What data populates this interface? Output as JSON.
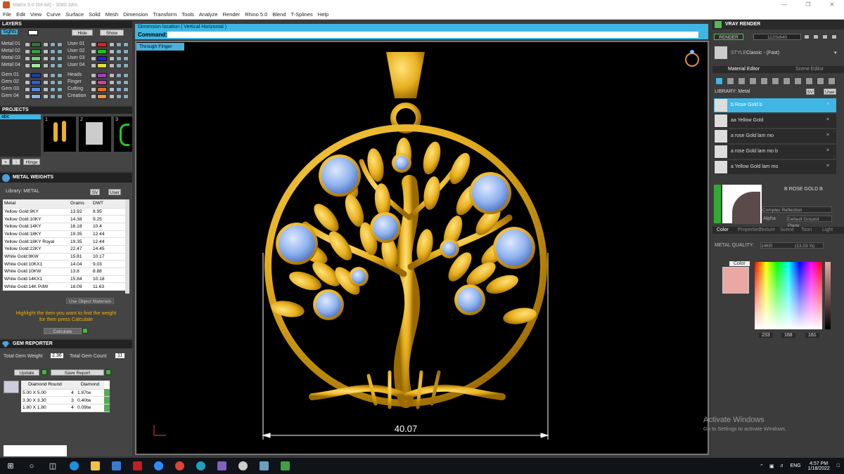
{
  "window": {
    "title": "Matrix 9.0 (64-bit) - 3080.3dm"
  },
  "menu": [
    "File",
    "Edit",
    "View",
    "Curve",
    "Surface",
    "Solid",
    "Mesh",
    "Dimension",
    "Transform",
    "Tools",
    "Analyze",
    "Render",
    "Rhino 5.0",
    "Blend",
    "T-Splines",
    "Help"
  ],
  "layers": {
    "title": "LAYERS",
    "first": "Sights",
    "hide": "Hide",
    "show": "Show",
    "left": [
      {
        "name": "Metal 01",
        "color": "#2a7a2a"
      },
      {
        "name": "Metal 02",
        "color": "#3b9a3b"
      },
      {
        "name": "Metal 03",
        "color": "#6fd06f"
      },
      {
        "name": "Metal 04",
        "color": "#9fe89f"
      },
      {
        "name": "Gem 01",
        "color": "#1a3fa0"
      },
      {
        "name": "Gem 02",
        "color": "#2d5fd0"
      },
      {
        "name": "Gem 03",
        "color": "#5a8ae0"
      },
      {
        "name": "Gem 04",
        "color": "#8db0f0"
      }
    ],
    "right": [
      {
        "name": "User 01",
        "color": "#e02020"
      },
      {
        "name": "User 02",
        "color": "#20c020"
      },
      {
        "name": "User 03",
        "color": "#2020e0"
      },
      {
        "name": "User 04",
        "color": "#e0e040"
      },
      {
        "name": "Heads",
        "color": "#a040c0"
      },
      {
        "name": "Finger",
        "color": "#d040a0"
      },
      {
        "name": "Cutting",
        "color": "#e07020"
      },
      {
        "name": "Creation",
        "color": "#f09040"
      }
    ]
  },
  "projects": {
    "title": "PROJECTS",
    "item": "abc",
    "thumbs": [
      "1",
      "2",
      "3"
    ],
    "hinge": "Hinge"
  },
  "metal_weights": {
    "title": "METAL WEIGHTS",
    "library": "Library: METAL",
    "sv": "SV",
    "user": "User",
    "headers": [
      "Metal",
      "Grams",
      "DWT"
    ],
    "rows": [
      [
        "Yellow Gold:9KY",
        "13.92",
        "8.95"
      ],
      [
        "Yellow Gold:10KY",
        "14.38",
        "9.25"
      ],
      [
        "Yellow Gold:14KY",
        "16.18",
        "10.4"
      ],
      [
        "Yellow Gold:18KY",
        "19.35",
        "12.44"
      ],
      [
        "Yellow Gold:18KY Royal",
        "19.35",
        "12.44"
      ],
      [
        "Yellow Gold:22KY",
        "22.47",
        "14.45"
      ],
      [
        "White Gold:9KW",
        "15.81",
        "10.17"
      ],
      [
        "White Gold:10KX1",
        "14.04",
        "9.03"
      ],
      [
        "White Gold:10KW",
        "13.8",
        "8.88"
      ],
      [
        "White Gold:14KX1",
        "15.84",
        "10.18"
      ],
      [
        "White Gold:14K PdW",
        "18.09",
        "11.63"
      ]
    ],
    "use_object": "Use Object Materials",
    "hint1": "Highlight the item you want to find the weight",
    "hint2": "for then press Calculate",
    "calculate": "Calculate"
  },
  "gem_reporter": {
    "title": "GEM REPORTER",
    "total_weight_label": "Total Gem Weight",
    "total_weight": "2.36",
    "total_count_label": "Total Gem Count",
    "total_count": "11",
    "update": "Update",
    "save": "Save Report",
    "headers": [
      "Diamond Round",
      "",
      "Diamond"
    ],
    "rows": [
      [
        "5.00 X 5.00",
        "4",
        "1.87tw"
      ],
      [
        "3.30 X 3.30",
        "3",
        "0.40tw"
      ],
      [
        "1.80 X 1.80",
        "4",
        "0.09tw"
      ]
    ]
  },
  "command": {
    "prompt": "Dimension location ( Vertical  Horizontal )",
    "label": "Command:"
  },
  "osnap": "Through Finger",
  "dimension": "40.07",
  "vray": {
    "title": "VRAY RENDER",
    "render": "RENDER",
    "size": "1120x840",
    "style_label": "STYLE",
    "style_value": "Classic - (Fast)",
    "tabs": [
      "Material Editor",
      "Scene Editor"
    ],
    "library": "LIBRARY: Metal",
    "sv": "SV",
    "user": "User",
    "materials": [
      "b Rose Gold b",
      "aa Yellow Gold",
      "a rose Gold lam mo",
      "a rose Gold lam mo b",
      "a Yellow Gold lam mo"
    ],
    "preview_name": "B ROSE GOLD B",
    "reflection": "Complex Reflection",
    "alpha": "Alpha",
    "ground": "Default Ground Plane",
    "subtabs": [
      "Color",
      "Properties",
      "Texture",
      "Scene",
      "Toon",
      "Light"
    ],
    "metal_quality_label": "METAL QUALITY:",
    "metal_quality": "14KR",
    "metal_quality_val": "(13.03 %)",
    "color_label": "Color",
    "rgb": [
      "233",
      "168",
      "161"
    ],
    "swatch": "#e9a8a1"
  },
  "activate": {
    "line1": "Activate Windows",
    "line2": "Go to Settings to activate Windows."
  },
  "taskbar": {
    "time": "4:57 PM",
    "date": "1/18/2022",
    "lang": "ENG"
  }
}
